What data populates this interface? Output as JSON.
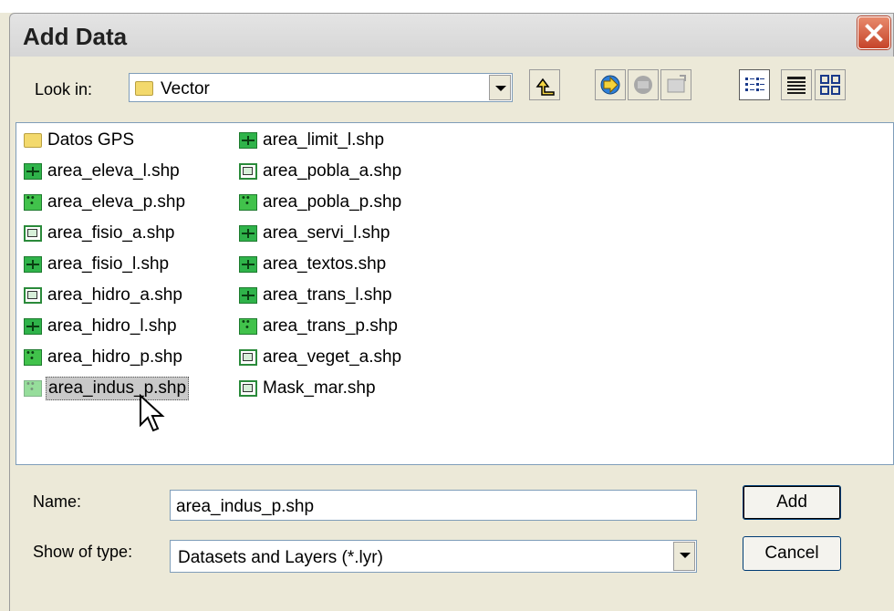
{
  "window": {
    "title": "Add Data"
  },
  "lookin": {
    "label": "Look in:",
    "value": "Vector",
    "icon": "folder-icon"
  },
  "toolbar": {
    "buttons": [
      {
        "name": "up-one-level-icon"
      },
      {
        "name": "connect-to-folder-icon"
      },
      {
        "name": "disconnect-folder-icon"
      },
      {
        "name": "catalog-icon"
      },
      {
        "name": "list-view-icon"
      },
      {
        "name": "details-view-icon"
      },
      {
        "name": "thumbnails-view-icon"
      }
    ]
  },
  "files": {
    "col1": [
      {
        "name": "Datos GPS",
        "icon": "folder"
      },
      {
        "name": "area_eleva_l.shp",
        "icon": "line"
      },
      {
        "name": "area_eleva_p.shp",
        "icon": "point"
      },
      {
        "name": "area_fisio_a.shp",
        "icon": "poly"
      },
      {
        "name": "area_fisio_l.shp",
        "icon": "line"
      },
      {
        "name": "area_hidro_a.shp",
        "icon": "poly"
      },
      {
        "name": "area_hidro_l.shp",
        "icon": "line"
      },
      {
        "name": "area_hidro_p.shp",
        "icon": "point"
      },
      {
        "name": "area_indus_p.shp",
        "icon": "point",
        "selected": true
      }
    ],
    "col2": [
      {
        "name": "area_limit_l.shp",
        "icon": "line"
      },
      {
        "name": "area_pobla_a.shp",
        "icon": "poly"
      },
      {
        "name": "area_pobla_p.shp",
        "icon": "point"
      },
      {
        "name": "area_servi_l.shp",
        "icon": "line"
      },
      {
        "name": "area_textos.shp",
        "icon": "line"
      },
      {
        "name": "area_trans_l.shp",
        "icon": "line"
      },
      {
        "name": "area_trans_p.shp",
        "icon": "point"
      },
      {
        "name": "area_veget_a.shp",
        "icon": "poly"
      },
      {
        "name": "Mask_mar.shp",
        "icon": "poly"
      }
    ]
  },
  "name_field": {
    "label": "Name:",
    "value": "area_indus_p.shp"
  },
  "type_field": {
    "label": "Show of type:",
    "value": "Datasets and Layers (*.lyr)"
  },
  "buttons": {
    "add": "Add",
    "cancel": "Cancel"
  }
}
